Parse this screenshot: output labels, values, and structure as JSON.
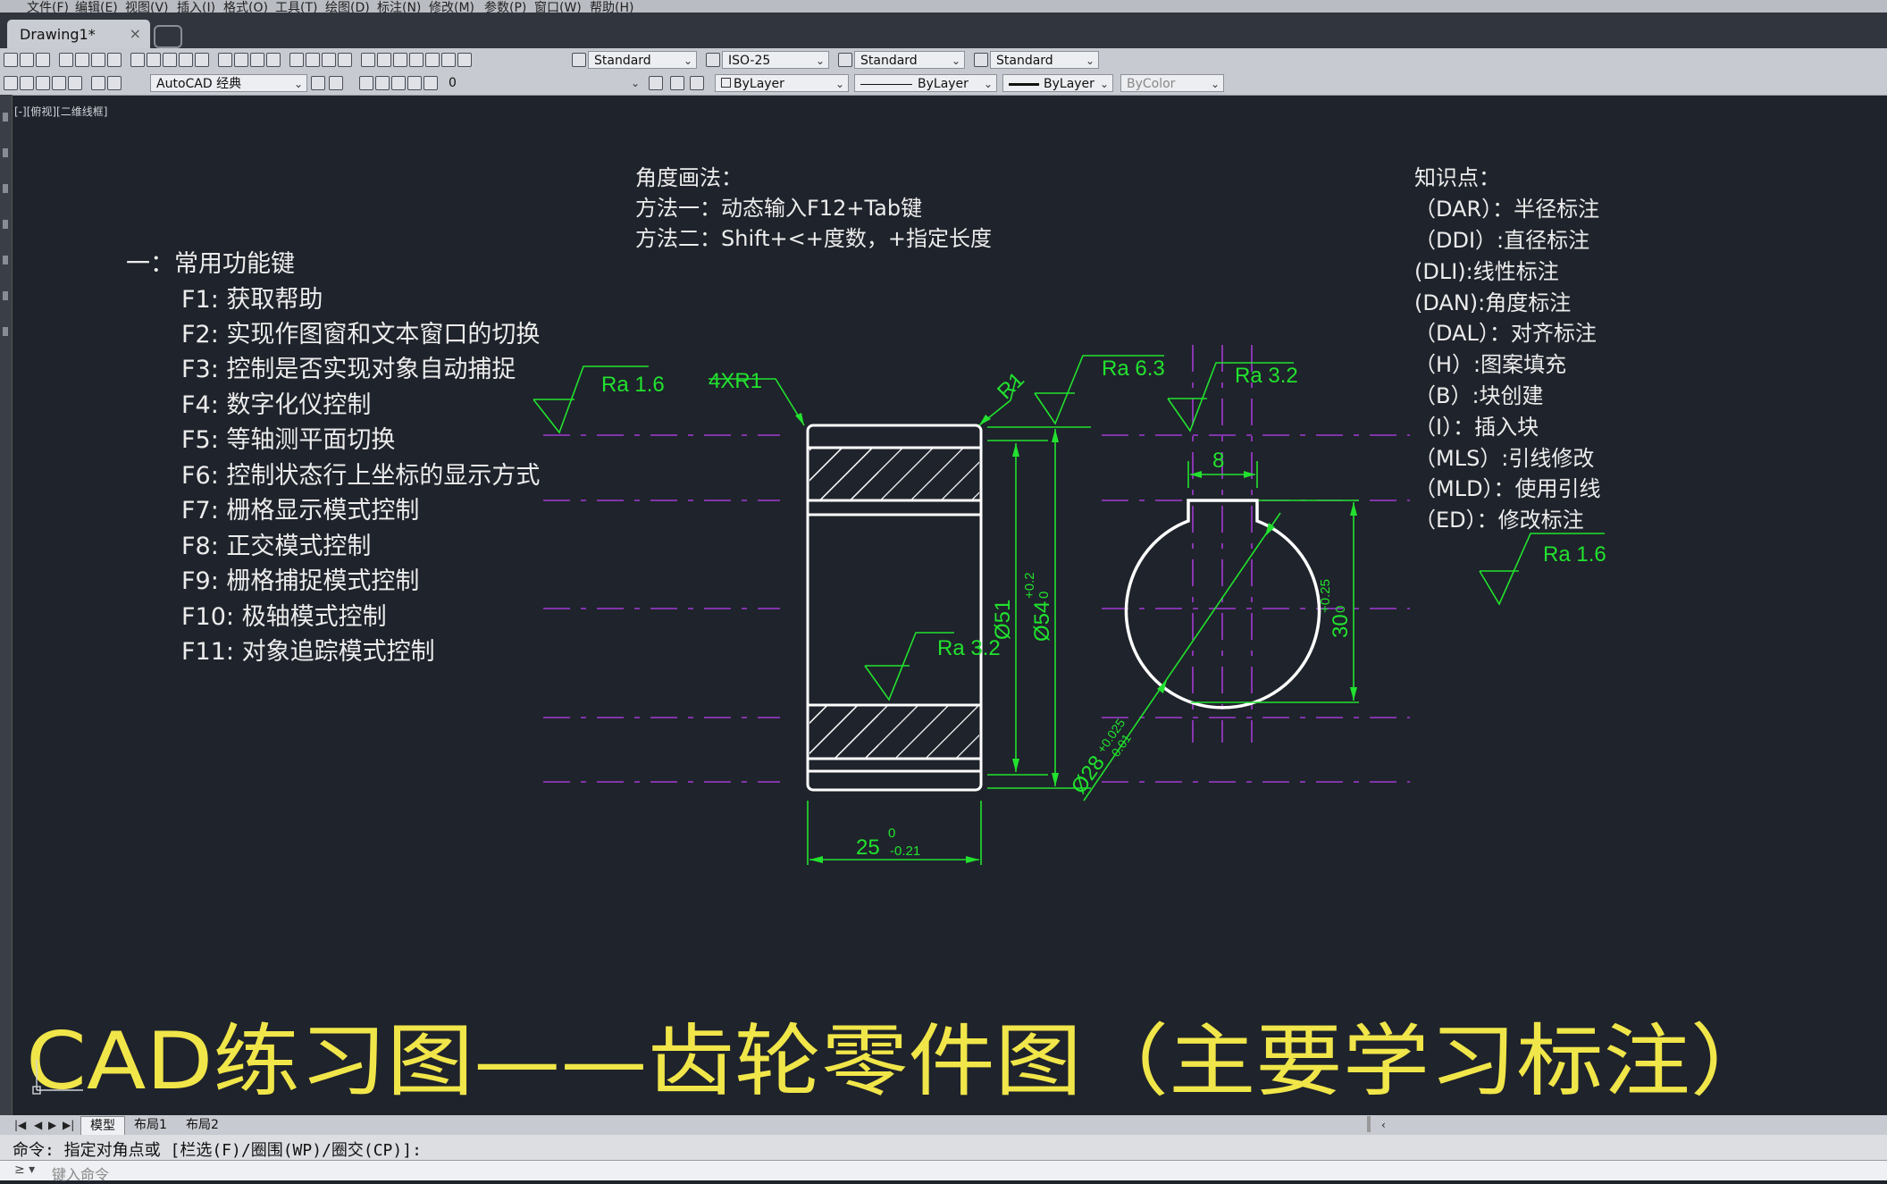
{
  "menu": [
    "文件(F)",
    "编辑(E)",
    "视图(V)",
    "插入(I)",
    "格式(O)",
    "工具(T)",
    "绘图(D)",
    "标注(N)",
    "修改(M)",
    "参数(P)",
    "窗口(W)",
    "帮助(H)"
  ],
  "doc_tab": {
    "title": "Drawing1*",
    "close": "×"
  },
  "toolbar": {
    "text_style": "Standard",
    "dim_style": "ISO-25",
    "table_style": "Standard",
    "mleader_style": "Standard",
    "workspace": "AutoCAD 经典",
    "layer": "0",
    "color": "ByLayer",
    "linetype": "ByLayer",
    "lineweight": "ByLayer",
    "plotstyle": "ByColor"
  },
  "viewport_label": "[-][俯视][二维线框]",
  "shortcut_notes": {
    "heading": "一：常用功能键",
    "items": [
      "F1: 获取帮助",
      "F2: 实现作图窗和文本窗口的切换",
      "F3: 控制是否实现对象自动捕捉",
      "F4: 数字化仪控制",
      "F5: 等轴测平面切换",
      "F6: 控制状态行上坐标的显示方式",
      "F7: 栅格显示模式控制",
      "F8: 正交模式控制",
      "F9: 栅格捕捉模式控制",
      "F10: 极轴模式控制",
      "F11: 对象追踪模式控制"
    ]
  },
  "angle_notes": [
    "角度画法：",
    "方法一：动态输入F12+Tab键",
    "方法二：Shift+<+度数，+指定长度"
  ],
  "knowledge_notes": [
    "知识点：",
    "（DAR）：半径标注",
    "（DDI）:直径标注",
    "(DLI):线性标注",
    "(DAN):角度标注",
    "（DAL）：对齐标注",
    "（H）:图案填充",
    "（B）:块创建",
    "（I）：插入块",
    "（MLS）:引线修改",
    "（MLD）：使用引线",
    "（ED）：修改标注"
  ],
  "annotations": {
    "ra_left": "Ra 1.6",
    "chamfer": "4XR1",
    "r1": "R1",
    "ra_top": "Ra 6.3",
    "ra_right": "Ra 3.2",
    "ra_bore": "Ra 3.2",
    "ra_notes": "Ra 1.6",
    "d51": "Ø51",
    "d54": "Ø54",
    "d54_tol_upper": "+0.2",
    "d54_tol_lower": "0",
    "width": "25",
    "width_tol_upper": "0",
    "width_tol_lower": "-0.21",
    "key_width": "8",
    "key_depth": "30",
    "key_tol_upper": "+0.25",
    "key_tol_lower": "0",
    "bore_dia": "Ø28",
    "bore_tol_upper": "+0.025",
    "bore_tol_lower": "0.01"
  },
  "banner": "CAD练习图——齿轮零件图（主要学习标注）",
  "layout_tabs": [
    "模型",
    "布局1",
    "布局2"
  ],
  "command_line": "命令: 指定对角点或 [栏选(F)/圈围(WP)/圈交(CP)]:",
  "command_prompt": "≥ ▾",
  "command_placeholder": "键入命令",
  "colors": {
    "background": "#1f232b",
    "annotation": "#22e22f",
    "centerline": "#a23bd4",
    "geometry": "#ffffff",
    "text": "#ececec",
    "banner": "#f1e649"
  }
}
